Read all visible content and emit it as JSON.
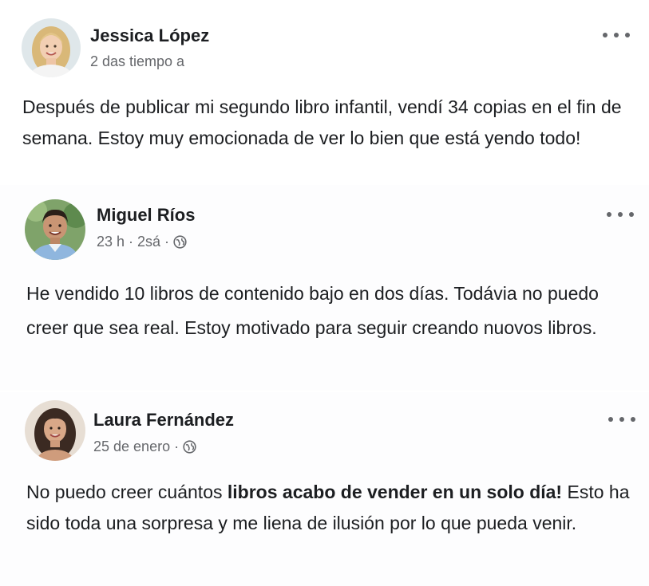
{
  "posts": [
    {
      "author": "Jessica López",
      "time": "2 das tiempo a",
      "text": "Después de publicar mi segundo libro infantil, vendí 34 copias en el fin de semana. Estoy muy emocionada de ver lo bien que está yendo todo!",
      "avatar_icon": "avatar-woman-blonde"
    },
    {
      "author": "Miguel Ríos",
      "time": "23 h · 2sá ·",
      "text": "He vendido 10 libros de contenido bajo en dos días. Todávia no puedo creer que sea real. Estoy motivado para seguir creando nuovos libros.",
      "avatar_icon": "avatar-man-dark-hair"
    },
    {
      "author": "Laura Fernández",
      "time": "25 de enero ·",
      "text_parts": [
        "No puedo creer cuántos ",
        "libros acabo de vender en un solo día!",
        " Esto ha sido toda una sorpresa y me liena de ilusión por lo que pueda venir."
      ],
      "avatar_icon": "avatar-woman-dark-hair"
    }
  ],
  "icons": {
    "more": "more-options-icon",
    "globe": "globe-icon"
  },
  "colors": {
    "text": "#1c1e21",
    "secondary": "#65676b",
    "background": "#ffffff"
  }
}
